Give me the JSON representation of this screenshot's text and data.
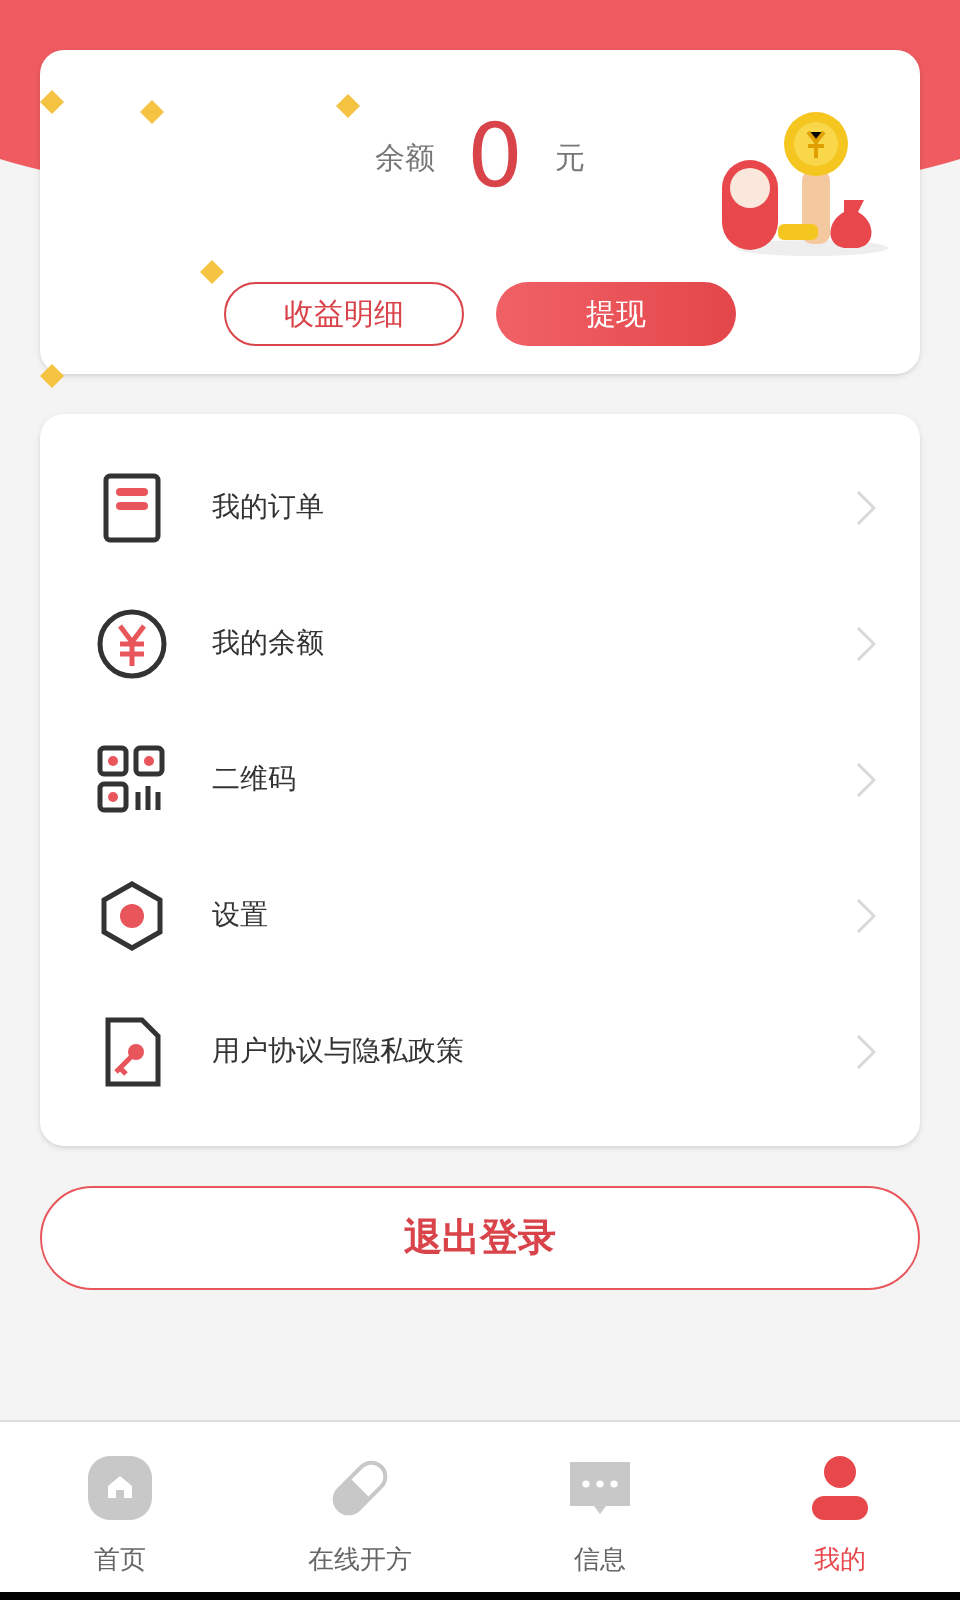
{
  "balance": {
    "label": "余额",
    "amount": "0",
    "unit": "元"
  },
  "balance_buttons": [
    {
      "label": "收益明细",
      "kind": "outline"
    },
    {
      "label": "提现",
      "kind": "filled"
    }
  ],
  "menu": [
    {
      "label": "我的订单",
      "kind": "order"
    },
    {
      "label": "我的余额",
      "kind": "balance"
    },
    {
      "label": "二维码",
      "kind": "qrcode"
    },
    {
      "label": "设置",
      "kind": "settings"
    },
    {
      "label": "用户协议与隐私政策",
      "kind": "policy"
    }
  ],
  "logout_button": "退出登录",
  "tabs": [
    {
      "label": "首页",
      "kind": "home",
      "selected": false
    },
    {
      "label": "在线开方",
      "kind": "pill",
      "selected": false
    },
    {
      "label": "信息",
      "kind": "message",
      "selected": false
    },
    {
      "label": "我的",
      "kind": "profile",
      "selected": true
    }
  ]
}
